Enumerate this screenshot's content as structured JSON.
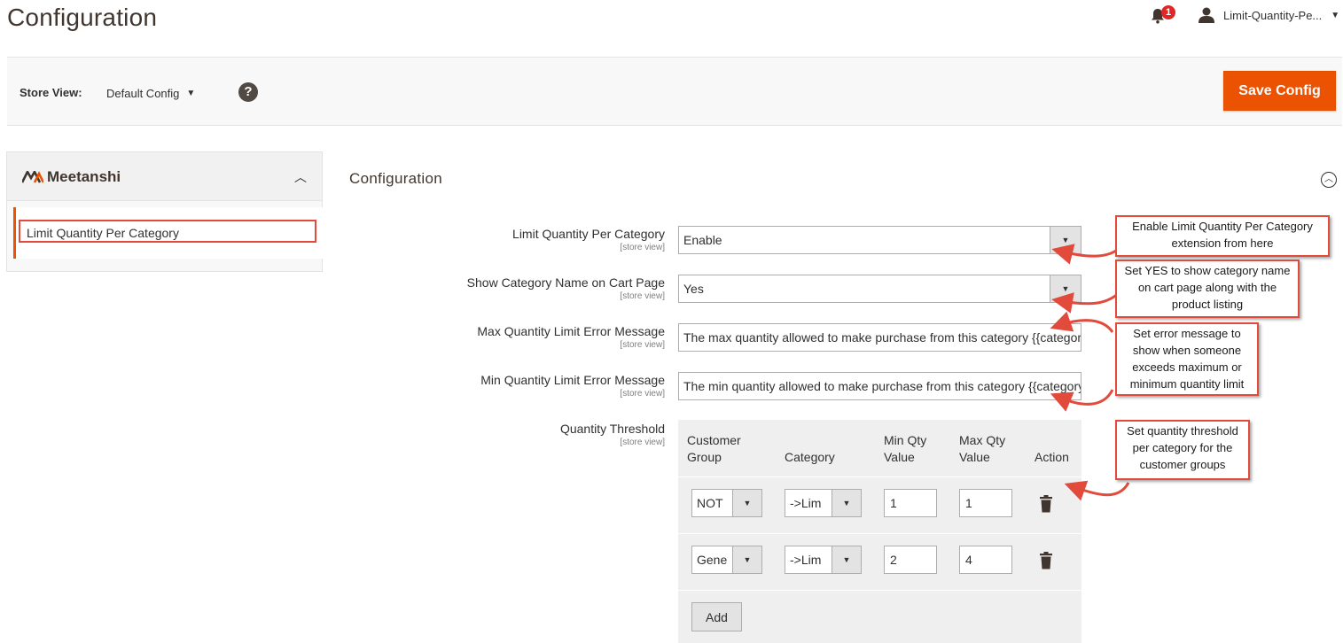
{
  "header": {
    "page_title": "Configuration",
    "notification_count": "1",
    "user_name": "Limit-Quantity-Pe..."
  },
  "store_view": {
    "label": "Store View:",
    "value": "Default Config",
    "save_label": "Save Config"
  },
  "sidebar": {
    "brand": "Meetanshi",
    "items": [
      {
        "label": "Limit Quantity Per Category"
      }
    ]
  },
  "section": {
    "title": "Configuration"
  },
  "fields": {
    "limit_qty": {
      "label": "Limit Quantity Per Category",
      "scope": "[store view]",
      "value": "Enable"
    },
    "show_category": {
      "label": "Show Category Name on Cart Page",
      "scope": "[store view]",
      "value": "Yes"
    },
    "max_error": {
      "label": "Max Quantity Limit Error Message",
      "scope": "[store view]",
      "value": "The max quantity allowed to make purchase from this category {{category}}"
    },
    "min_error": {
      "label": "Min Quantity Limit Error Message",
      "scope": "[store view]",
      "value": "The min quantity allowed to make purchase from this category {{category}}"
    },
    "threshold": {
      "label": "Quantity Threshold",
      "scope": "[store view]"
    }
  },
  "threshold_table": {
    "headers": {
      "customer_group_1": "Customer",
      "customer_group_2": "Group",
      "category": "Category",
      "min_qty_1": "Min Qty",
      "min_qty_2": "Value",
      "max_qty_1": "Max Qty",
      "max_qty_2": "Value",
      "action": "Action"
    },
    "rows": [
      {
        "group": "NOT",
        "category": "->Lim",
        "min": "1",
        "max": "1"
      },
      {
        "group": "Gene",
        "category": "->Lim",
        "min": "2",
        "max": "4"
      }
    ],
    "add_label": "Add"
  },
  "callouts": {
    "c1": "Enable Limit Quantity Per Category extension from here",
    "c2": "Set YES to show category name on cart page along with the product listing",
    "c3": "Set error message to show when someone exceeds maximum or minimum quantity limit",
    "c4": "Set quantity threshold per category for the customer groups"
  },
  "colors": {
    "accent": "#eb5202",
    "callout_border": "#e24a3b",
    "title": "#41362f"
  }
}
